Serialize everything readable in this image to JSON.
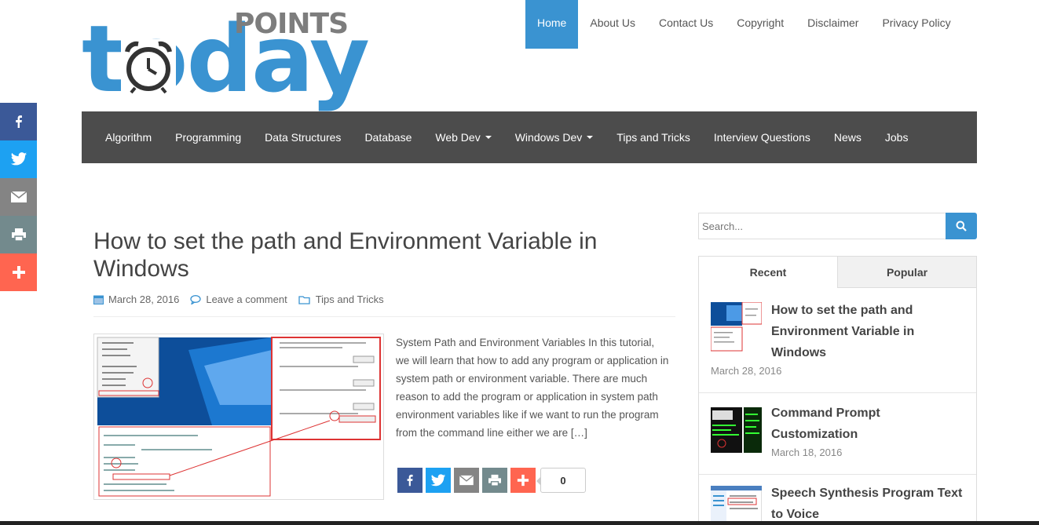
{
  "logo": {
    "word": "today",
    "badge": "POINTS"
  },
  "topnav": [
    {
      "label": "Home",
      "active": true
    },
    {
      "label": "About Us"
    },
    {
      "label": "Contact Us"
    },
    {
      "label": "Copyright"
    },
    {
      "label": "Disclaimer"
    },
    {
      "label": "Privacy Policy"
    }
  ],
  "mainnav": [
    {
      "label": "Algorithm"
    },
    {
      "label": "Programming"
    },
    {
      "label": "Data Structures"
    },
    {
      "label": "Database"
    },
    {
      "label": "Web Dev",
      "dropdown": true
    },
    {
      "label": "Windows Dev",
      "dropdown": true
    },
    {
      "label": "Tips and Tricks"
    },
    {
      "label": "Interview Questions"
    },
    {
      "label": "News"
    },
    {
      "label": "Jobs"
    }
  ],
  "share_sidebar": [
    "facebook-icon",
    "twitter-icon",
    "email-icon",
    "print-icon",
    "plus-icon"
  ],
  "post": {
    "title": "How to set the path and Environment Variable in Windows",
    "date": "March 28, 2016",
    "comment": "Leave a comment",
    "category": "Tips and Tricks",
    "excerpt": "System Path and Environment Variables In this tutorial, we will learn that how to add any program or application in system path or environment variable. There are much reason to add the program or application in system path environment variables like if we want to run the program from the command line either we are […]",
    "share_count": "0"
  },
  "search": {
    "placeholder": "Search..."
  },
  "tabs": {
    "recent": "Recent",
    "popular": "Popular"
  },
  "recent": [
    {
      "title": "How to set the path and Environment Variable in Windows",
      "date": "March 28, 2016"
    },
    {
      "title": "Command Prompt Customization",
      "date": "March 18, 2016"
    },
    {
      "title": "Speech Synthesis Program Text to Voice",
      "date": ""
    }
  ],
  "colors": {
    "brand": "#3a93d1",
    "nav": "#4c4c4c",
    "facebook": "#3b5998",
    "twitter": "#1da1f2",
    "plus": "#ff6550"
  }
}
